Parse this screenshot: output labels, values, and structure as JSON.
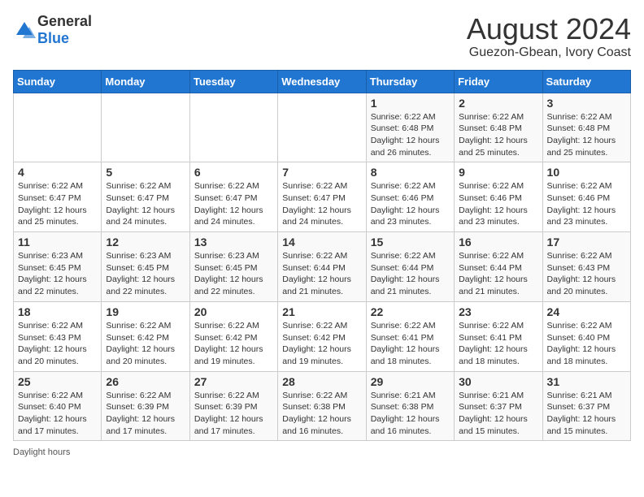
{
  "header": {
    "logo_general": "General",
    "logo_blue": "Blue",
    "title": "August 2024",
    "subtitle": "Guezon-Gbean, Ivory Coast"
  },
  "days_of_week": [
    "Sunday",
    "Monday",
    "Tuesday",
    "Wednesday",
    "Thursday",
    "Friday",
    "Saturday"
  ],
  "weeks": [
    [
      {
        "day": "",
        "detail": ""
      },
      {
        "day": "",
        "detail": ""
      },
      {
        "day": "",
        "detail": ""
      },
      {
        "day": "",
        "detail": ""
      },
      {
        "day": "1",
        "detail": "Sunrise: 6:22 AM\nSunset: 6:48 PM\nDaylight: 12 hours\nand 26 minutes."
      },
      {
        "day": "2",
        "detail": "Sunrise: 6:22 AM\nSunset: 6:48 PM\nDaylight: 12 hours\nand 25 minutes."
      },
      {
        "day": "3",
        "detail": "Sunrise: 6:22 AM\nSunset: 6:48 PM\nDaylight: 12 hours\nand 25 minutes."
      }
    ],
    [
      {
        "day": "4",
        "detail": "Sunrise: 6:22 AM\nSunset: 6:47 PM\nDaylight: 12 hours\nand 25 minutes."
      },
      {
        "day": "5",
        "detail": "Sunrise: 6:22 AM\nSunset: 6:47 PM\nDaylight: 12 hours\nand 24 minutes."
      },
      {
        "day": "6",
        "detail": "Sunrise: 6:22 AM\nSunset: 6:47 PM\nDaylight: 12 hours\nand 24 minutes."
      },
      {
        "day": "7",
        "detail": "Sunrise: 6:22 AM\nSunset: 6:47 PM\nDaylight: 12 hours\nand 24 minutes."
      },
      {
        "day": "8",
        "detail": "Sunrise: 6:22 AM\nSunset: 6:46 PM\nDaylight: 12 hours\nand 23 minutes."
      },
      {
        "day": "9",
        "detail": "Sunrise: 6:22 AM\nSunset: 6:46 PM\nDaylight: 12 hours\nand 23 minutes."
      },
      {
        "day": "10",
        "detail": "Sunrise: 6:22 AM\nSunset: 6:46 PM\nDaylight: 12 hours\nand 23 minutes."
      }
    ],
    [
      {
        "day": "11",
        "detail": "Sunrise: 6:23 AM\nSunset: 6:45 PM\nDaylight: 12 hours\nand 22 minutes."
      },
      {
        "day": "12",
        "detail": "Sunrise: 6:23 AM\nSunset: 6:45 PM\nDaylight: 12 hours\nand 22 minutes."
      },
      {
        "day": "13",
        "detail": "Sunrise: 6:23 AM\nSunset: 6:45 PM\nDaylight: 12 hours\nand 22 minutes."
      },
      {
        "day": "14",
        "detail": "Sunrise: 6:22 AM\nSunset: 6:44 PM\nDaylight: 12 hours\nand 21 minutes."
      },
      {
        "day": "15",
        "detail": "Sunrise: 6:22 AM\nSunset: 6:44 PM\nDaylight: 12 hours\nand 21 minutes."
      },
      {
        "day": "16",
        "detail": "Sunrise: 6:22 AM\nSunset: 6:44 PM\nDaylight: 12 hours\nand 21 minutes."
      },
      {
        "day": "17",
        "detail": "Sunrise: 6:22 AM\nSunset: 6:43 PM\nDaylight: 12 hours\nand 20 minutes."
      }
    ],
    [
      {
        "day": "18",
        "detail": "Sunrise: 6:22 AM\nSunset: 6:43 PM\nDaylight: 12 hours\nand 20 minutes."
      },
      {
        "day": "19",
        "detail": "Sunrise: 6:22 AM\nSunset: 6:42 PM\nDaylight: 12 hours\nand 20 minutes."
      },
      {
        "day": "20",
        "detail": "Sunrise: 6:22 AM\nSunset: 6:42 PM\nDaylight: 12 hours\nand 19 minutes."
      },
      {
        "day": "21",
        "detail": "Sunrise: 6:22 AM\nSunset: 6:42 PM\nDaylight: 12 hours\nand 19 minutes."
      },
      {
        "day": "22",
        "detail": "Sunrise: 6:22 AM\nSunset: 6:41 PM\nDaylight: 12 hours\nand 18 minutes."
      },
      {
        "day": "23",
        "detail": "Sunrise: 6:22 AM\nSunset: 6:41 PM\nDaylight: 12 hours\nand 18 minutes."
      },
      {
        "day": "24",
        "detail": "Sunrise: 6:22 AM\nSunset: 6:40 PM\nDaylight: 12 hours\nand 18 minutes."
      }
    ],
    [
      {
        "day": "25",
        "detail": "Sunrise: 6:22 AM\nSunset: 6:40 PM\nDaylight: 12 hours\nand 17 minutes."
      },
      {
        "day": "26",
        "detail": "Sunrise: 6:22 AM\nSunset: 6:39 PM\nDaylight: 12 hours\nand 17 minutes."
      },
      {
        "day": "27",
        "detail": "Sunrise: 6:22 AM\nSunset: 6:39 PM\nDaylight: 12 hours\nand 17 minutes."
      },
      {
        "day": "28",
        "detail": "Sunrise: 6:22 AM\nSunset: 6:38 PM\nDaylight: 12 hours\nand 16 minutes."
      },
      {
        "day": "29",
        "detail": "Sunrise: 6:21 AM\nSunset: 6:38 PM\nDaylight: 12 hours\nand 16 minutes."
      },
      {
        "day": "30",
        "detail": "Sunrise: 6:21 AM\nSunset: 6:37 PM\nDaylight: 12 hours\nand 15 minutes."
      },
      {
        "day": "31",
        "detail": "Sunrise: 6:21 AM\nSunset: 6:37 PM\nDaylight: 12 hours\nand 15 minutes."
      }
    ]
  ],
  "footer": "Daylight hours"
}
